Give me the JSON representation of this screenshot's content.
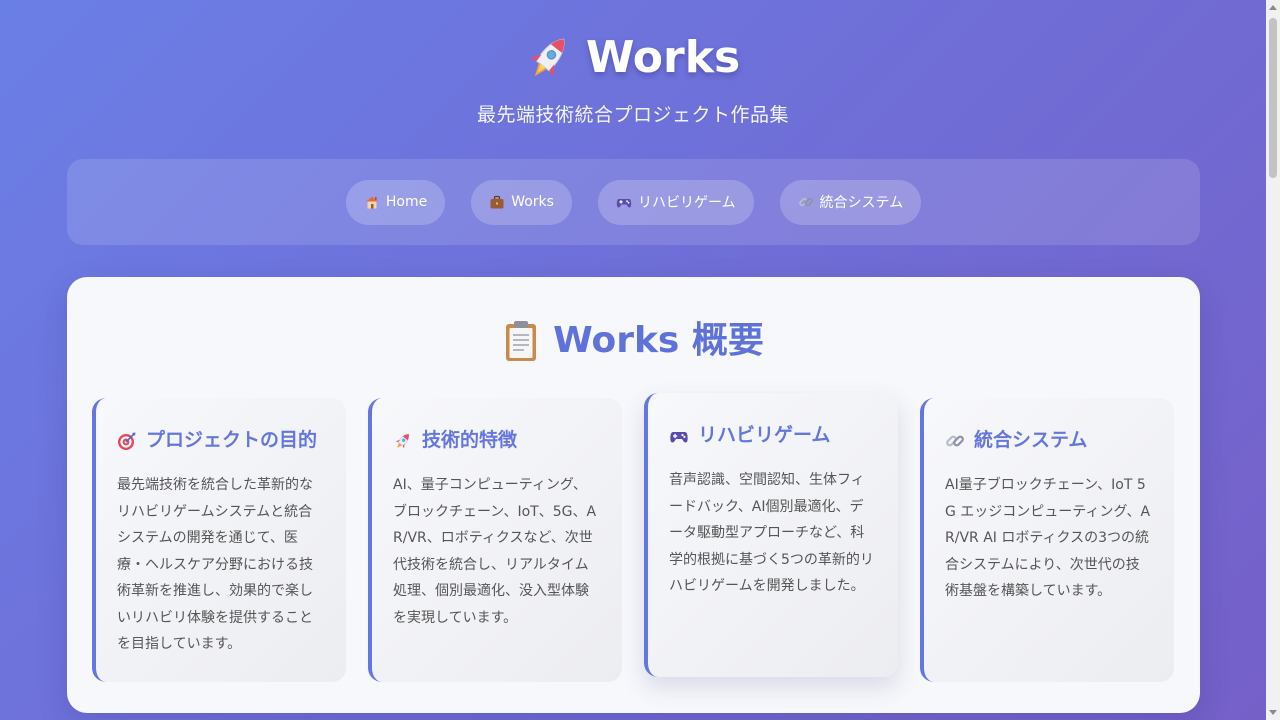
{
  "header": {
    "title": "Works",
    "subtitle": "最先端技術統合プロジェクト作品集",
    "title_icon": "rocket-icon"
  },
  "nav": {
    "items": [
      {
        "label": "Home",
        "icon": "house-icon"
      },
      {
        "label": "Works",
        "icon": "briefcase-icon"
      },
      {
        "label": "リハビリゲーム",
        "icon": "gamepad-icon"
      },
      {
        "label": "統合システム",
        "icon": "link-icon"
      }
    ]
  },
  "main": {
    "title": "Works 概要",
    "title_icon": "clipboard-icon",
    "cards": [
      {
        "title": "プロジェクトの目的",
        "icon": "target-icon",
        "body": "最先端技術を統合した革新的なリハビリゲームシステムと統合システムの開発を通じて、医療・ヘルスケア分野における技術革新を推進し、効果的で楽しいリハビリ体験を提供することを目指しています。"
      },
      {
        "title": "技術的特徴",
        "icon": "rocket-icon",
        "body": "AI、量子コンピューティング、ブロックチェーン、IoT、5G、AR/VR、ロボティクスなど、次世代技術を統合し、リアルタイム処理、個別最適化、没入型体験を実現しています。"
      },
      {
        "title": "リハビリゲーム",
        "icon": "gamepad-icon",
        "body": "音声認識、空間認知、生体フィードバック、AI個別最適化、データ駆動型アプローチなど、科学的根拠に基づく5つの革新的リハビリゲームを開発しました。"
      },
      {
        "title": "統合システム",
        "icon": "link-icon",
        "body": "AI量子ブロックチェーン、IoT 5G エッジコンピューティング、AR/VR AI ロボティクスの3つの統合システムにより、次世代の技術基盤を構築しています。"
      }
    ]
  },
  "colors": {
    "accent": "#6577de",
    "background_start": "#6a7fe6",
    "background_end": "#7560c8",
    "panel": "#f7f8fc"
  }
}
